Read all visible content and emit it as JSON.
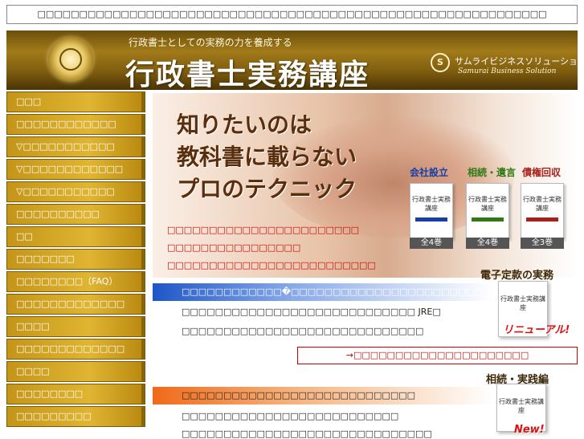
{
  "top_notice": "□□□□□□□□□□□□□□□□□□□□□□□□□□□□□□□□□□□□□□□□□□□□□□□□□□□□□□□□□□□□□",
  "banner": {
    "subtitle": "行政書士としての実務の力を養成する",
    "title": "行政書士実務講座",
    "brand_jp": "サムライビジネスソリューション",
    "brand_en": "Samurai Business Solution",
    "brand_mark": "S"
  },
  "sidebar": {
    "items": [
      {
        "label": "□□□"
      },
      {
        "label": "□□□□□□□□□□□□"
      },
      {
        "label": "▽□□□□□□□□□□□"
      },
      {
        "label": "▽□□□□□□□□□□□□"
      },
      {
        "label": "▽□□□□□□□□□□□"
      },
      {
        "label": "□□□□□□□□□□"
      },
      {
        "label": "□□"
      },
      {
        "label": "□□□□□□□"
      },
      {
        "label": "□□□□□□□□（FAQ）"
      },
      {
        "label": "□□□□□□□□□□□□□"
      },
      {
        "label": "□□□□"
      },
      {
        "label": "□□□□□□□□□□□□□"
      },
      {
        "label": "□□□□"
      },
      {
        "label": "□□□□□□□□"
      },
      {
        "label": "□□□□□□□□□"
      }
    ]
  },
  "hero": {
    "line1": "知りたいのは",
    "line2": "教科書に載らない",
    "line3": "プロのテクニック",
    "categories": [
      {
        "label": "会社設立",
        "color": "#1a3ea8"
      },
      {
        "label": "相続・遺言",
        "color": "#2f7a12"
      },
      {
        "label": "債権回収",
        "color": "#a8201a"
      }
    ],
    "book_title": "行政書士実務講座",
    "book_counts": [
      "全4巻",
      "全4巻",
      "全3巻"
    ]
  },
  "promo_lines": [
    "□□□□□□□□□□□□□□□□□□□□□□□",
    "□□□□□□□□□□□□□□□□",
    "□□□□□□□□□□□□□□□□□□□□□□□□□"
  ],
  "box1": {
    "header": "□□□□□□□□□□□□�□□□□□□□□□□□□□□□□□□□□□□□",
    "lines": [
      "□□□□□□□□□□□□□□□□□□□□□□□□□□□□ JRE□",
      "□□□□□□□□□□□□□□□□□□□□□□□□□□□□□"
    ]
  },
  "link_box": "→□□□□□□□□□□□□□□□□□□□□□",
  "box2": {
    "header": "□□□□□□□□□□□□□□□□□□□□□□□□□□□□",
    "lines": [
      "□□□□□□□□□□□□□□□□□□□□□□□□□□",
      "□□□□□□□□□□□□□□□□□□□□□□□□□□□□□□"
    ]
  },
  "side_promos": [
    {
      "title": "電子定款の実務",
      "ribbon": "リニューアル!"
    },
    {
      "title": "相続・実践編",
      "ribbon": "New!"
    }
  ],
  "colors": {
    "banner_gold": "#a27a1a",
    "nav_gold": "#e0b532",
    "red_text": "#cc0000",
    "blue_header": "#1e56c8",
    "orange_header": "#f06a18"
  }
}
